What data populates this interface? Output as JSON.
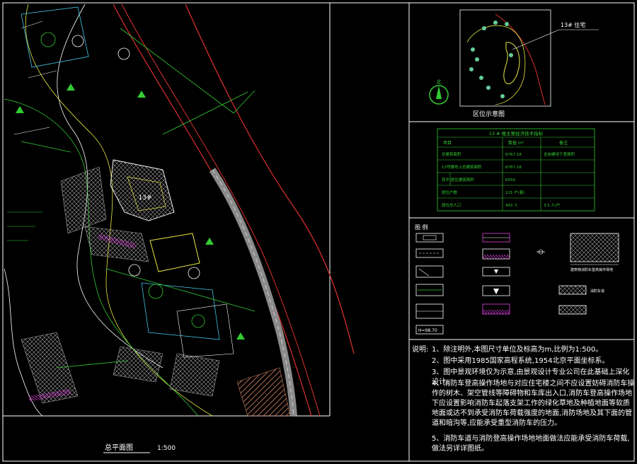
{
  "colors": {
    "background": "#000000",
    "frame": "#ffffff",
    "road_red": "#e03030",
    "green": "#33cc33",
    "yellow": "#e8e840",
    "cyan": "#40c8e8",
    "magenta": "#e040e0",
    "hatch_grey": "#a0a0a0"
  },
  "plan": {
    "title": "总平面图",
    "scale": "1:500",
    "building_label": "13#"
  },
  "location_map": {
    "title": "区位示意图",
    "building_label": "13# 住宅",
    "north_label": "北"
  },
  "tech_table": {
    "title": "13 # 楼主要经济技术指标",
    "headers": [
      "项目",
      "数值 m²",
      "备注"
    ],
    "rows": [
      [
        "总建筑面积",
        "6767.18",
        "含自建地下室面积"
      ],
      [
        "13号楼地上总建筑面积",
        "6767.18",
        ""
      ],
      [
        "其中  居住建筑面积",
        "6556",
        ""
      ],
      [
        "居住户数",
        "121  户(套)",
        ""
      ],
      [
        "居住总人口",
        "443  人",
        "3.5  人/户"
      ]
    ]
  },
  "legend": {
    "title": "图  例",
    "fill_label": "建筑物消防车登高操作场地",
    "items": [
      "",
      "",
      "",
      "",
      "",
      "",
      "",
      "",
      "",
      "",
      "消防车道",
      "H=98.70"
    ]
  },
  "notes": {
    "heading": "说明:",
    "items": [
      "1、除注明外,本图尺寸单位及标高为m,比例为1:500。",
      "2、图中采用1985国家高程系统,1954北京平面坐标系。",
      "3、图中景观环境仅为示意,由景观设计专业公司在此基础上深化设计。",
      "4、消防车登高操作场地与对应住宅楼之间不应设置妨碍消防车操作的树木、架空管线等障碍物和车库出入口,消防车登高操作场地下应设置影响消防车起落支架工作的绿化草地及种植地面等软质地面或达不到承受消防车荷载强度的地面,消防场地及其下面的管道和暗沟等,应能承受重型消防车的压力。",
      "5、消防车道与消防登高操作场地地面做法应能承受消防车荷载,做法另详详图纸。"
    ]
  }
}
